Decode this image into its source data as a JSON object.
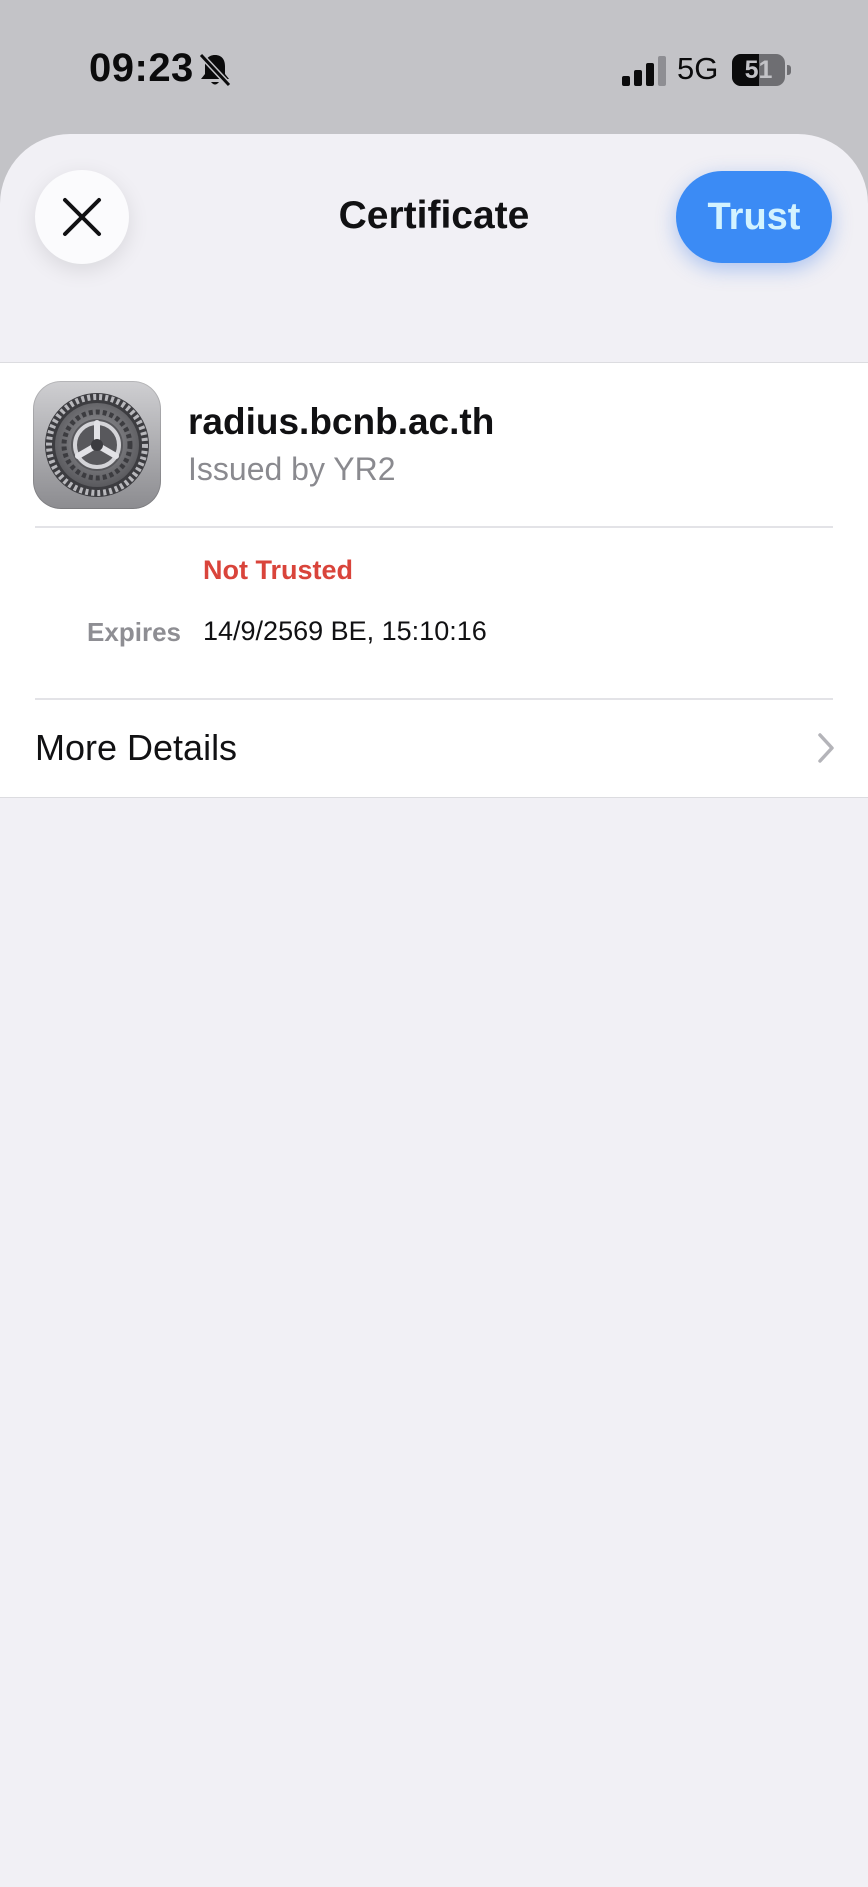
{
  "status_bar": {
    "time": "09:23",
    "network": "5G",
    "battery_level": "51",
    "battery_fraction": 0.51,
    "icons": [
      "bell-slash-icon",
      "cellular-signal-icon",
      "battery-icon"
    ]
  },
  "sheet": {
    "title": "Certificate",
    "close_icon": "close-icon",
    "trust_label": "Trust",
    "accent_color": "#3b8bf5"
  },
  "certificate": {
    "name": "radius.bcnb.ac.th",
    "issuer": "Issued by YR2",
    "icon": "settings-gear-icon",
    "trust_status": "Not Trusted",
    "trust_status_color": "#d9443b",
    "expires_label": "Expires",
    "expires_value": "14/9/2569 BE, 15:10:16"
  },
  "more_details": {
    "label": "More Details",
    "icon": "chevron-right-icon"
  }
}
